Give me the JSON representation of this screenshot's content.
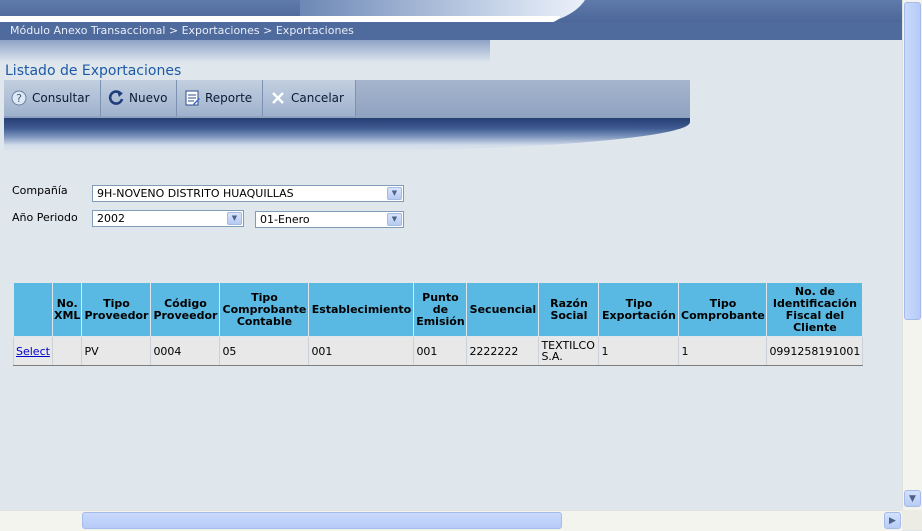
{
  "breadcrumb": "Módulo Anexo Transaccional > Exportaciones > Exportaciones",
  "page_title": "Listado de Exportaciones",
  "toolbar": [
    {
      "icon": "help-icon",
      "label": "Consultar"
    },
    {
      "icon": "refresh-icon",
      "label": "Nuevo"
    },
    {
      "icon": "report-icon",
      "label": "Reporte"
    },
    {
      "icon": "close-icon",
      "label": "Cancelar"
    }
  ],
  "form": {
    "company_label": "Compañía",
    "company_value": "9H-NOVENO DISTRITO HUAQUILLAS",
    "period_label": "Año Periodo",
    "year_value": "2002",
    "month_value": "01-Enero"
  },
  "grid": {
    "headers": [
      "",
      "No. XML",
      "Tipo Proveedor",
      "Código Proveedor",
      "Tipo Comprobante Contable",
      "Establecimiento",
      "Punto de Emisión",
      "Secuencial",
      "Razón Social",
      "Tipo Exportación",
      "Tipo Comprobante",
      "No. de Identificación Fiscal del Cliente"
    ],
    "rows": [
      [
        "Select",
        "",
        "PV",
        "0004",
        "05",
        "001",
        "001",
        "2222222",
        "TEXTILCO S.A.",
        "1",
        "1",
        "0991258191001"
      ]
    ]
  },
  "colors": {
    "header_bg": "#5ab9e2",
    "title": "#1d5aa6",
    "page_bg": "#dfe6ec"
  }
}
